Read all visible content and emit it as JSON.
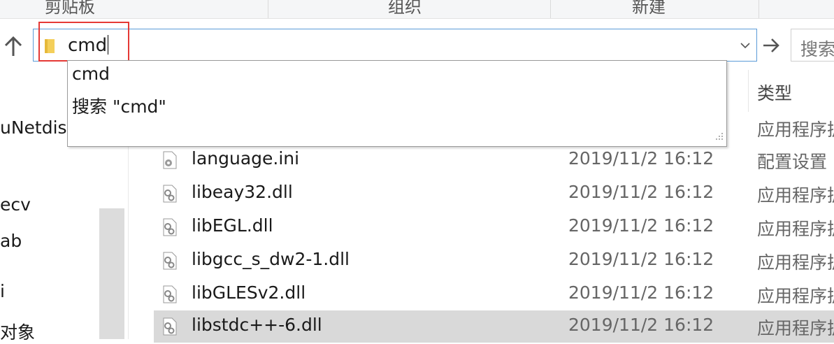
{
  "ribbon": {
    "groups": [
      "剪贴板",
      "组织",
      "新建"
    ]
  },
  "address_bar": {
    "value": "cmd",
    "folder_icon": "folder-icon",
    "dropdown_icon": "chevron-down-icon"
  },
  "search": {
    "placeholder": "搜索"
  },
  "autocomplete": {
    "options": [
      "cmd",
      "搜索 \"cmd\""
    ]
  },
  "nav_pane": {
    "items": [
      "uNetdis",
      "ecv",
      "ab",
      "i",
      "对象"
    ]
  },
  "columns": {
    "type": "类型"
  },
  "files": [
    {
      "name": "",
      "date": "",
      "type": "应用程序扩展"
    },
    {
      "name": "language.ini",
      "date": "2019/11/2 16:12",
      "type": "配置设置"
    },
    {
      "name": "libeay32.dll",
      "date": "2019/11/2 16:12",
      "type": "应用程序扩展"
    },
    {
      "name": "libEGL.dll",
      "date": "2019/11/2 16:12",
      "type": "应用程序扩展"
    },
    {
      "name": "libgcc_s_dw2-1.dll",
      "date": "2019/11/2 16:12",
      "type": "应用程序扩展"
    },
    {
      "name": "libGLESv2.dll",
      "date": "2019/11/2 16:12",
      "type": "应用程序扩展"
    },
    {
      "name": "libstdc++-6.dll",
      "date": "2019/11/2 16:12",
      "type": "应用程序扩展"
    }
  ],
  "colors": {
    "address_border": "#5a9bd8",
    "highlight_box": "#e53935",
    "selected_row": "#d9d9d9"
  }
}
